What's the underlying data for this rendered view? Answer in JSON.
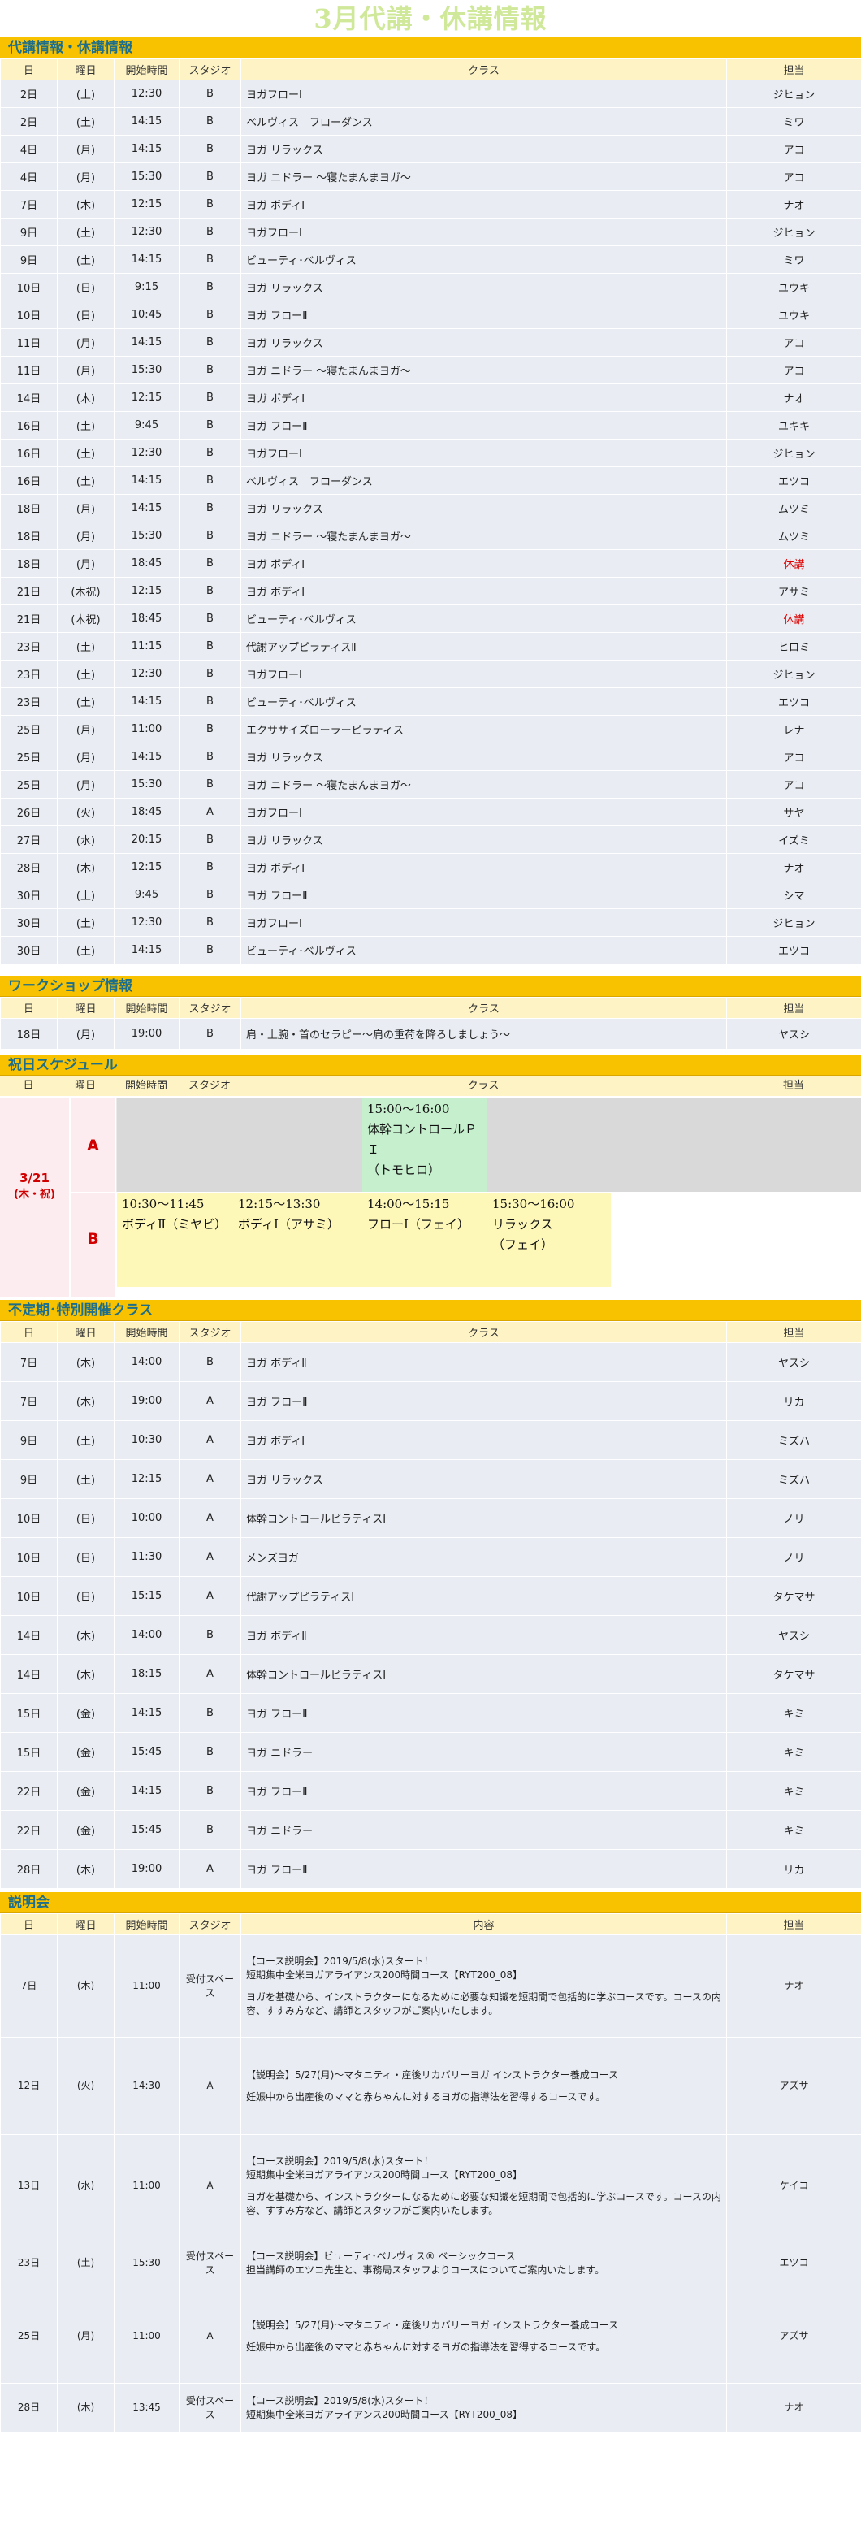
{
  "title": "3月代講・休講情報",
  "sections": {
    "substitute": {
      "title": "代講情報・休講情報",
      "columns": [
        "日",
        "曜日",
        "開始時間",
        "スタジオ",
        "クラス",
        "担当"
      ],
      "rows": [
        [
          "2日",
          "(土)",
          "12:30",
          "B",
          "ヨガフローⅠ",
          "ジヒョン"
        ],
        [
          "2日",
          "(土)",
          "14:15",
          "B",
          "ベルヴィス　フローダンス",
          "ミワ"
        ],
        [
          "4日",
          "(月)",
          "14:15",
          "B",
          "ヨガ リラックス",
          "アコ"
        ],
        [
          "4日",
          "(月)",
          "15:30",
          "B",
          "ヨガ ニドラー ～寝たまんまヨガ～",
          "アコ"
        ],
        [
          "7日",
          "(木)",
          "12:15",
          "B",
          "ヨガ ボディⅠ",
          "ナオ"
        ],
        [
          "9日",
          "(土)",
          "12:30",
          "B",
          "ヨガフローⅠ",
          "ジヒョン"
        ],
        [
          "9日",
          "(土)",
          "14:15",
          "B",
          "ビューティ･ベルヴィス",
          "ミワ"
        ],
        [
          "10日",
          "(日)",
          "9:15",
          "B",
          "ヨガ リラックス",
          "ユウキ"
        ],
        [
          "10日",
          "(日)",
          "10:45",
          "B",
          "ヨガ フローⅡ",
          "ユウキ"
        ],
        [
          "11日",
          "(月)",
          "14:15",
          "B",
          "ヨガ リラックス",
          "アコ"
        ],
        [
          "11日",
          "(月)",
          "15:30",
          "B",
          "ヨガ ニドラー ～寝たまんまヨガ～",
          "アコ"
        ],
        [
          "14日",
          "(木)",
          "12:15",
          "B",
          "ヨガ ボディⅠ",
          "ナオ"
        ],
        [
          "16日",
          "(土)",
          "9:45",
          "B",
          "ヨガ フローⅡ",
          "ユキキ"
        ],
        [
          "16日",
          "(土)",
          "12:30",
          "B",
          "ヨガフローⅠ",
          "ジヒョン"
        ],
        [
          "16日",
          "(土)",
          "14:15",
          "B",
          "ベルヴィス　フローダンス",
          "エツコ"
        ],
        [
          "18日",
          "(月)",
          "14:15",
          "B",
          "ヨガ リラックス",
          "ムツミ"
        ],
        [
          "18日",
          "(月)",
          "15:30",
          "B",
          "ヨガ ニドラー ～寝たまんまヨガ～",
          "ムツミ"
        ],
        [
          "18日",
          "(月)",
          "18:45",
          "B",
          "ヨガ ボディⅠ",
          "休講"
        ],
        [
          "21日",
          "(木祝)",
          "12:15",
          "B",
          "ヨガ ボディⅠ",
          "アサミ"
        ],
        [
          "21日",
          "(木祝)",
          "18:45",
          "B",
          "ビューティ･ベルヴィス",
          "休講"
        ],
        [
          "23日",
          "(土)",
          "11:15",
          "B",
          "代謝アップピラティスⅡ",
          "ヒロミ"
        ],
        [
          "23日",
          "(土)",
          "12:30",
          "B",
          "ヨガフローⅠ",
          "ジヒョン"
        ],
        [
          "23日",
          "(土)",
          "14:15",
          "B",
          "ビューティ･ベルヴィス",
          "エツコ"
        ],
        [
          "25日",
          "(月)",
          "11:00",
          "B",
          "エクササイズローラーピラティス",
          "レナ"
        ],
        [
          "25日",
          "(月)",
          "14:15",
          "B",
          "ヨガ リラックス",
          "アコ"
        ],
        [
          "25日",
          "(月)",
          "15:30",
          "B",
          "ヨガ ニドラー ～寝たまんまヨガ～",
          "アコ"
        ],
        [
          "26日",
          "(火)",
          "18:45",
          "A",
          "ヨガフローⅠ",
          "サヤ"
        ],
        [
          "27日",
          "(水)",
          "20:15",
          "B",
          "ヨガ リラックス",
          "イズミ"
        ],
        [
          "28日",
          "(木)",
          "12:15",
          "B",
          "ヨガ ボディⅠ",
          "ナオ"
        ],
        [
          "30日",
          "(土)",
          "9:45",
          "B",
          "ヨガ フローⅡ",
          "シマ"
        ],
        [
          "30日",
          "(土)",
          "12:30",
          "B",
          "ヨガフローⅠ",
          "ジヒョン"
        ],
        [
          "30日",
          "(土)",
          "14:15",
          "B",
          "ビューティ･ベルヴィス",
          "エツコ"
        ]
      ]
    },
    "workshop": {
      "title": "ワークショップ情報",
      "columns": [
        "日",
        "曜日",
        "開始時間",
        "スタジオ",
        "クラス",
        "担当"
      ],
      "rows": [
        [
          "18日",
          "(月)",
          "19:00",
          "B",
          "肩・上腕・首のセラピー～肩の重荷を降ろしましょう～",
          "ヤスシ"
        ]
      ]
    },
    "holiday": {
      "title": "祝日スケジュール",
      "columns": [
        "日",
        "曜日",
        "開始時間",
        "スタジオ",
        "クラス",
        "担当"
      ],
      "date": "3/21",
      "day": "(木・祝)",
      "studio_a": "A",
      "studio_b": "B",
      "a_class": {
        "time": "15:00～16:00",
        "name": "体幹コントロールＰＩ",
        "teacher": "（トモヒロ）"
      },
      "b_classes": [
        {
          "time": "10:30～11:45",
          "name": "ボディⅡ（ミヤビ）"
        },
        {
          "time": "12:15～13:30",
          "name": "ボディⅠ（アサミ）"
        },
        {
          "time": "14:00～15:15",
          "name": "フローⅠ（フェイ）"
        },
        {
          "time": "15:30～16:00",
          "name": "リラックス",
          "teacher": "（フェイ）"
        }
      ]
    },
    "irregular": {
      "title": "不定期･特別開催クラス",
      "columns": [
        "日",
        "曜日",
        "開始時間",
        "スタジオ",
        "クラス",
        "担当"
      ],
      "rows": [
        [
          "7日",
          "(木)",
          "14:00",
          "B",
          "ヨガ ボディⅡ",
          "ヤスシ"
        ],
        [
          "7日",
          "(木)",
          "19:00",
          "A",
          "ヨガ フローⅡ",
          "リカ"
        ],
        [
          "9日",
          "(土)",
          "10:30",
          "A",
          "ヨガ ボディⅠ",
          "ミズハ"
        ],
        [
          "9日",
          "(土)",
          "12:15",
          "A",
          "ヨガ リラックス",
          "ミズハ"
        ],
        [
          "10日",
          "(日)",
          "10:00",
          "A",
          "体幹コントロールピラティスⅠ",
          "ノリ"
        ],
        [
          "10日",
          "(日)",
          "11:30",
          "A",
          "メンズヨガ",
          "ノリ"
        ],
        [
          "10日",
          "(日)",
          "15:15",
          "A",
          "代謝アップピラティスⅠ",
          "タケマサ"
        ],
        [
          "14日",
          "(木)",
          "14:00",
          "B",
          "ヨガ ボディⅡ",
          "ヤスシ"
        ],
        [
          "14日",
          "(木)",
          "18:15",
          "A",
          "体幹コントロールピラティスⅠ",
          "タケマサ"
        ],
        [
          "15日",
          "(金)",
          "14:15",
          "B",
          "ヨガ フローⅡ",
          "キミ"
        ],
        [
          "15日",
          "(金)",
          "15:45",
          "B",
          "ヨガ ニドラー",
          "キミ"
        ],
        [
          "22日",
          "(金)",
          "14:15",
          "B",
          "ヨガ フローⅡ",
          "キミ"
        ],
        [
          "22日",
          "(金)",
          "15:45",
          "B",
          "ヨガ ニドラー",
          "キミ"
        ],
        [
          "28日",
          "(木)",
          "19:00",
          "A",
          "ヨガ フローⅡ",
          "リカ"
        ]
      ]
    },
    "briefing": {
      "title": "説明会",
      "columns": [
        "日",
        "曜日",
        "開始時間",
        "スタジオ",
        "内容",
        "担当"
      ],
      "rows": [
        {
          "day": "7日",
          "dow": "(木)",
          "time": "11:00",
          "studio": "受付スペース",
          "lines": [
            "【コース説明会】2019/5/8(水)スタート！",
            "短期集中全米ヨガアライアンス200時間コース【RYT200_08】",
            "",
            "ヨガを基礎から、インストラクターになるために必要な知識を短期間で包括的に学ぶコースです。コースの内容、すすみ方など、講師とスタッフがご案内いたします。"
          ],
          "teacher": "ナオ"
        },
        {
          "day": "12日",
          "dow": "(火)",
          "time": "14:30",
          "studio": "A",
          "lines": [
            "【説明会】5/27(月)～マタニティ・産後リカバリーヨガ インストラクター養成コース",
            "",
            "妊娠中から出産後のママと赤ちゃんに対するヨガの指導法を習得するコースです。"
          ],
          "teacher": "アズサ"
        },
        {
          "day": "13日",
          "dow": "(水)",
          "time": "11:00",
          "studio": "A",
          "lines": [
            "【コース説明会】2019/5/8(水)スタート！",
            "短期集中全米ヨガアライアンス200時間コース【RYT200_08】",
            "",
            "ヨガを基礎から、インストラクターになるために必要な知識を短期間で包括的に学ぶコースです。コースの内容、すすみ方など、講師とスタッフがご案内いたします。"
          ],
          "teacher": "ケイコ"
        },
        {
          "day": "23日",
          "dow": "(土)",
          "time": "15:30",
          "studio": "受付スペース",
          "lines": [
            "【コース説明会】ビューティ･ベルヴィス® ベーシックコース",
            "担当講師のエツコ先生と、事務局スタッフよりコースについてご案内いたします。"
          ],
          "teacher": "エツコ"
        },
        {
          "day": "25日",
          "dow": "(月)",
          "time": "11:00",
          "studio": "A",
          "lines": [
            "【説明会】5/27(月)～マタニティ・産後リカバリーヨガ インストラクター養成コース",
            "",
            "妊娠中から出産後のママと赤ちゃんに対するヨガの指導法を習得するコースです。"
          ],
          "teacher": "アズサ"
        },
        {
          "day": "28日",
          "dow": "(木)",
          "time": "13:45",
          "studio": "受付スペース",
          "lines": [
            "【コース説明会】2019/5/8(水)スタート！",
            "短期集中全米ヨガアライアンス200時間コース【RYT200_08】"
          ],
          "teacher": "ナオ"
        }
      ]
    }
  },
  "colors": {
    "section_header_bg": "#f8c200",
    "column_header_bg": "#fdf3c4",
    "row_bg": "#e9edf3",
    "cancel_text": "#e00000",
    "holiday_date_text": "#d00000",
    "holiday_a_cell": "#c6efce",
    "holiday_b_cell": "#fdf7b8"
  }
}
